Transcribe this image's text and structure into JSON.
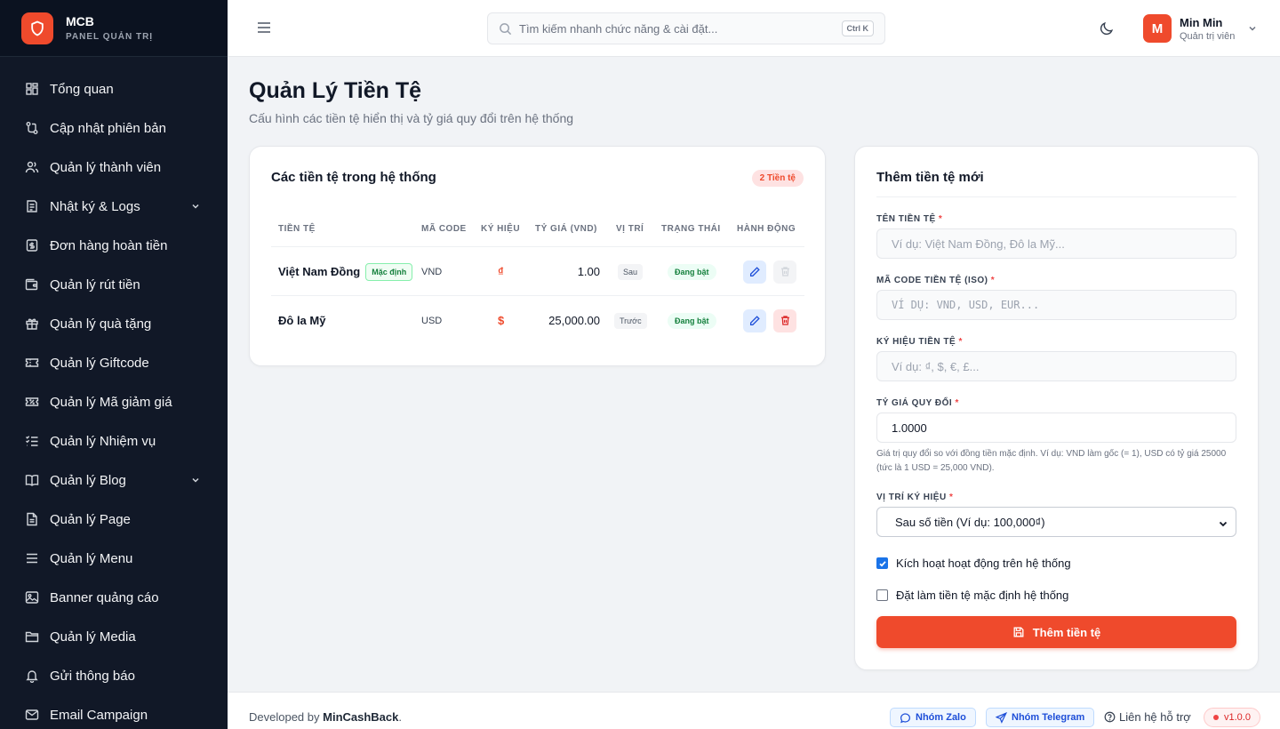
{
  "brand": {
    "name": "MCB",
    "subtitle": "PANEL QUẢN TRỊ"
  },
  "sidebar": {
    "items": [
      {
        "label": "Tổng quan",
        "icon": "dashboard-icon"
      },
      {
        "label": "Cập nhật phiên bản",
        "icon": "git-branch-icon"
      },
      {
        "label": "Quản lý thành viên",
        "icon": "users-icon"
      },
      {
        "label": "Nhật ký & Logs",
        "icon": "logs-icon",
        "expandable": true
      },
      {
        "label": "Đơn hàng hoàn tiền",
        "icon": "receipt-icon"
      },
      {
        "label": "Quản lý rút tiền",
        "icon": "wallet-icon"
      },
      {
        "label": "Quản lý quà tặng",
        "icon": "gift-icon"
      },
      {
        "label": "Quản lý Giftcode",
        "icon": "ticket-icon"
      },
      {
        "label": "Quản lý Mã giảm giá",
        "icon": "coupon-icon"
      },
      {
        "label": "Quản lý Nhiệm vụ",
        "icon": "checklist-icon"
      },
      {
        "label": "Quản lý Blog",
        "icon": "book-icon",
        "expandable": true
      },
      {
        "label": "Quản lý Page",
        "icon": "file-icon"
      },
      {
        "label": "Quản lý Menu",
        "icon": "menu-icon"
      },
      {
        "label": "Banner quảng cáo",
        "icon": "image-icon"
      },
      {
        "label": "Quản lý Media",
        "icon": "folder-icon"
      },
      {
        "label": "Gửi thông báo",
        "icon": "bell-icon"
      },
      {
        "label": "Email Campaign",
        "icon": "mail-icon"
      }
    ]
  },
  "topbar": {
    "search_placeholder": "Tìm kiếm nhanh chức năng & cài đặt...",
    "search_shortcut": "Ctrl K",
    "user": {
      "initial": "M",
      "name": "Min Min",
      "role": "Quản trị viên"
    }
  },
  "page": {
    "title": "Quản Lý Tiền Tệ",
    "subtitle": "Cấu hình các tiền tệ hiển thị và tỷ giá quy đổi trên hệ thống"
  },
  "currency_table": {
    "title": "Các tiền tệ trong hệ thống",
    "count_badge": "2 Tiền tệ",
    "headers": [
      "TIỀN TỆ",
      "MÃ CODE",
      "KÝ HIỆU",
      "TỶ GIÁ (VND)",
      "VỊ TRÍ",
      "TRẠNG THÁI",
      "HÀNH ĐỘNG"
    ],
    "default_badge": "Mặc định",
    "rows": [
      {
        "name": "Việt Nam Đồng",
        "is_default": true,
        "code": "VND",
        "symbol": "₫",
        "rate": "1.00",
        "position": "Sau",
        "status": "Đang bật",
        "delete_enabled": false
      },
      {
        "name": "Đô la Mỹ",
        "is_default": false,
        "code": "USD",
        "symbol": "$",
        "rate": "25,000.00",
        "position": "Trước",
        "status": "Đang bật",
        "delete_enabled": true
      }
    ]
  },
  "form": {
    "title": "Thêm tiền tệ mới",
    "name_label": "TÊN TIỀN TỆ",
    "name_placeholder": "Ví dụ: Việt Nam Đồng, Đô la Mỹ...",
    "code_label": "MÃ CODE TIỀN TỆ (ISO)",
    "code_placeholder": "VÍ DỤ: VND, USD, EUR...",
    "symbol_label": "KÝ HIỆU TIỀN TỆ",
    "symbol_placeholder": "Ví dụ: ₫, $, €, £...",
    "rate_label": "TỶ GIÁ QUY ĐỔI",
    "rate_value": "1.0000",
    "rate_help": "Giá trị quy đổi so với đồng tiền mặc định. Ví dụ: VND làm gốc (= 1), USD có tỷ giá 25000 (tức là 1 USD = 25,000 VND).",
    "position_label": "VỊ TRÍ KÝ HIỆU",
    "position_value": "Sau số tiền (Ví dụ: 100,000₫)",
    "active_label": "Kích hoạt hoạt động trên hệ thống",
    "active_checked": true,
    "default_label": "Đặt làm tiền tệ mặc định hệ thống",
    "default_checked": false,
    "required_mark": "*",
    "submit_label": "Thêm tiền tệ"
  },
  "footer": {
    "developed_by": "Developed by",
    "developer": "MinCashBack",
    "dot": ".",
    "zalo": "Nhóm Zalo",
    "telegram": "Nhóm Telegram",
    "support": "Liên hệ hỗ trợ",
    "version": "v1.0.0"
  },
  "colors": {
    "accent": "#ef4a2c",
    "sidebar_bg": "#111827",
    "success": "#15803d",
    "edit_blue": "#1d4ed8"
  }
}
